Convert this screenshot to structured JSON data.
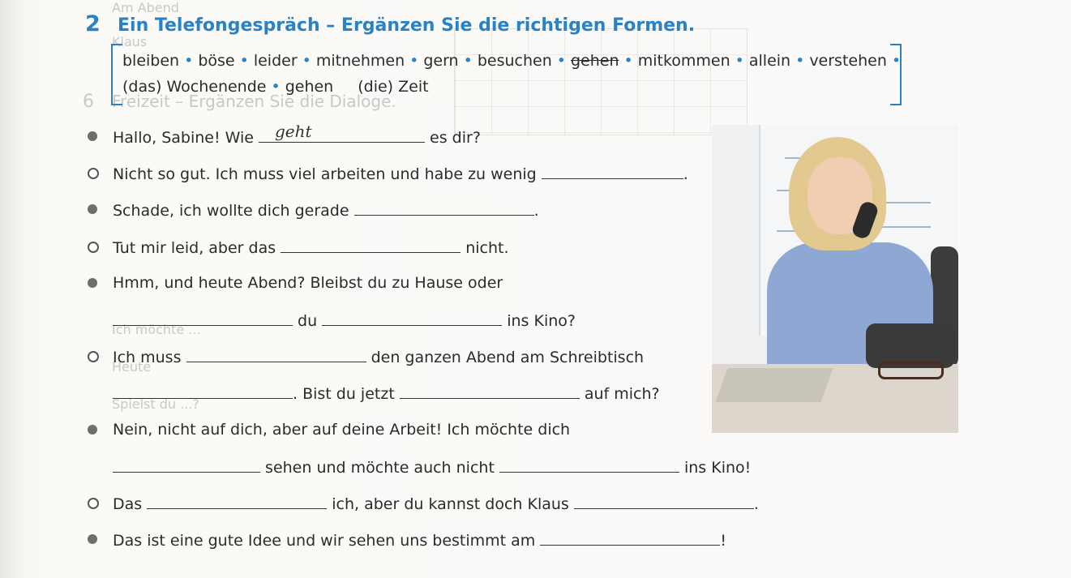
{
  "exercise": {
    "number": "2",
    "title": "Ein Telefongespräch – Ergänzen Sie die richtigen Formen."
  },
  "word_box": {
    "line1": [
      {
        "text": "bleiben",
        "struck": false
      },
      {
        "text": "böse",
        "struck": false
      },
      {
        "text": "leider",
        "struck": false
      },
      {
        "text": "mitnehmen",
        "struck": false
      },
      {
        "text": "gern",
        "struck": false
      },
      {
        "text": "besuchen",
        "struck": false
      },
      {
        "text": "gehen",
        "struck": true
      },
      {
        "text": "mitkommen",
        "struck": false
      },
      {
        "text": "allein",
        "struck": false
      },
      {
        "text": "verstehen",
        "struck": false
      }
    ],
    "line2": [
      {
        "text": "(das) Wochenende"
      },
      {
        "text": "gehen"
      },
      {
        "text": "(die) Zeit"
      }
    ],
    "separator": "•"
  },
  "dialogue": [
    {
      "bullet": "filled",
      "parts": [
        {
          "t": "Hallo, Sabine! Wie "
        },
        {
          "blank": 205,
          "fill": "geht"
        },
        {
          "t": " es dir?"
        }
      ]
    },
    {
      "bullet": "open",
      "parts": [
        {
          "t": "Nicht so gut. Ich muss viel arbeiten und habe zu wenig "
        },
        {
          "blank": 175
        },
        {
          "t": "."
        }
      ]
    },
    {
      "bullet": "filled",
      "parts": [
        {
          "t": "Schade, ich wollte dich gerade "
        },
        {
          "blank": 222
        },
        {
          "t": "."
        }
      ]
    },
    {
      "bullet": "open",
      "parts": [
        {
          "t": "Tut mir leid, aber das "
        },
        {
          "blank": 222
        },
        {
          "t": " nicht."
        }
      ]
    },
    {
      "bullet": "filled",
      "parts": [
        {
          "t": "Hmm, und heute Abend? Bleibst du zu Hause oder"
        }
      ]
    },
    {
      "bullet": "none",
      "parts": [
        {
          "blank": 222
        },
        {
          "t": " du "
        },
        {
          "blank": 222
        },
        {
          "t": " ins Kino?"
        }
      ]
    },
    {
      "bullet": "open",
      "parts": [
        {
          "t": "Ich muss "
        },
        {
          "blank": 222
        },
        {
          "t": " den ganzen Abend am Schreibtisch"
        }
      ]
    },
    {
      "bullet": "none",
      "parts": [
        {
          "blank": 222
        },
        {
          "t": ". Bist du jetzt "
        },
        {
          "blank": 222
        },
        {
          "t": " auf mich?"
        }
      ]
    },
    {
      "bullet": "filled",
      "parts": [
        {
          "t": "Nein, nicht auf dich, aber auf deine Arbeit! Ich möchte dich"
        }
      ]
    },
    {
      "bullet": "none",
      "parts": [
        {
          "blank": 182
        },
        {
          "t": " sehen und möchte auch nicht "
        },
        {
          "blank": 222
        },
        {
          "t": " ins Kino!"
        }
      ]
    },
    {
      "bullet": "open",
      "parts": [
        {
          "t": "Das "
        },
        {
          "blank": 222
        },
        {
          "t": " ich, aber du kannst doch Klaus "
        },
        {
          "blank": 222
        },
        {
          "t": "."
        }
      ]
    },
    {
      "bullet": "filled",
      "parts": [
        {
          "t": "Das ist eine gute Idee und wir sehen uns bestimmt am "
        },
        {
          "blank": 222
        },
        {
          "t": "!"
        }
      ]
    }
  ],
  "bleed_through": [
    "Am Abend",
    "Klaus",
    "6",
    "Freizeit – Ergänzen Sie die Dialoge.",
    "Heute",
    "Spielst du ...?",
    "Ich möchte ..."
  ]
}
